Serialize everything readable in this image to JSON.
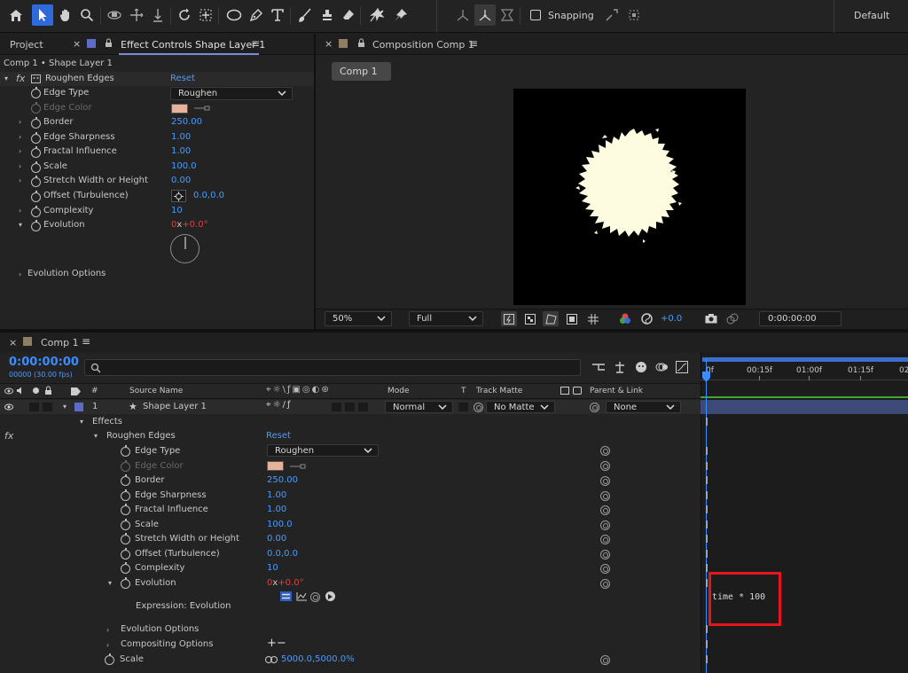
{
  "toolbar": {
    "snapping_label": "Snapping",
    "workspace_label": "Default"
  },
  "effect_controls": {
    "project_tab": "Project",
    "tab_label": "Effect Controls Shape Layer 1",
    "breadcrumb": "Comp 1 • Shape Layer 1",
    "effect_name": "Roughen Edges",
    "reset_label": "Reset",
    "properties": [
      {
        "label": "Edge Type",
        "value": "Roughen"
      },
      {
        "label": "Edge Color",
        "value": ""
      },
      {
        "label": "Border",
        "value": "250.00"
      },
      {
        "label": "Edge Sharpness",
        "value": "1.00"
      },
      {
        "label": "Fractal Influence",
        "value": "1.00"
      },
      {
        "label": "Scale",
        "value": "100.0"
      },
      {
        "label": "Stretch Width or Height",
        "value": "0.00"
      },
      {
        "label": "Offset (Turbulence)",
        "value": "0.0,0.0"
      },
      {
        "label": "Complexity",
        "value": "10"
      },
      {
        "label": "Evolution",
        "value": ""
      }
    ],
    "evolution_rev": "0",
    "evolution_x": "x",
    "evolution_deg": "+0.0°",
    "evolution_options": "Evolution Options"
  },
  "composition": {
    "tab_label": "Composition Comp 1",
    "comp_button": "Comp 1",
    "zoom": "50%",
    "resolution": "Full",
    "exposure": "+0.0",
    "timecode": "0:00:00:00"
  },
  "timeline": {
    "tab_label": "Comp 1",
    "timecode": "0:00:00:00",
    "frames_fps": "00000 (30.00 fps)",
    "search_placeholder": "",
    "headers": {
      "number": "#",
      "source": "Source Name",
      "mode": "Mode",
      "t": "T",
      "track_matte": "Track Matte",
      "parent": "Parent & Link"
    },
    "layer": {
      "number": "1",
      "name": "Shape Layer 1",
      "mode": "Normal",
      "matte": "No Matte",
      "parent": "None"
    },
    "effects_label": "Effects",
    "effect_name": "Roughen Edges",
    "reset_label": "Reset",
    "properties": [
      {
        "label": "Edge Type",
        "value": "Roughen"
      },
      {
        "label": "Edge Color",
        "value": ""
      },
      {
        "label": "Border",
        "value": "250.00"
      },
      {
        "label": "Edge Sharpness",
        "value": "1.00"
      },
      {
        "label": "Fractal Influence",
        "value": "1.00"
      },
      {
        "label": "Scale",
        "value": "100.0"
      },
      {
        "label": "Stretch Width or Height",
        "value": "0.00"
      },
      {
        "label": "Offset (Turbulence)",
        "value": "0.0,0.0"
      },
      {
        "label": "Complexity",
        "value": "10"
      },
      {
        "label": "Evolution",
        "value": ""
      }
    ],
    "evolution_rev": "0",
    "evolution_x": "x",
    "evolution_deg": "+0.0°",
    "expression_label": "Expression: Evolution",
    "evolution_options": "Evolution Options",
    "compositing_options": "Compositing Options",
    "scale_label": "Scale",
    "scale_value": "5000.0,5000.0%",
    "ruler": [
      "0f",
      "00:15f",
      "01:00f",
      "01:15f",
      "02"
    ],
    "expression_text": "time * 100"
  },
  "colors": {
    "accent": "#2d6bdc",
    "value_blue": "#4a9bff",
    "keyframe_red": "#e0403c",
    "edge_color": "#e8b199",
    "shape_fill": "#fdfbe0",
    "highlight_box": "#e8141e"
  }
}
